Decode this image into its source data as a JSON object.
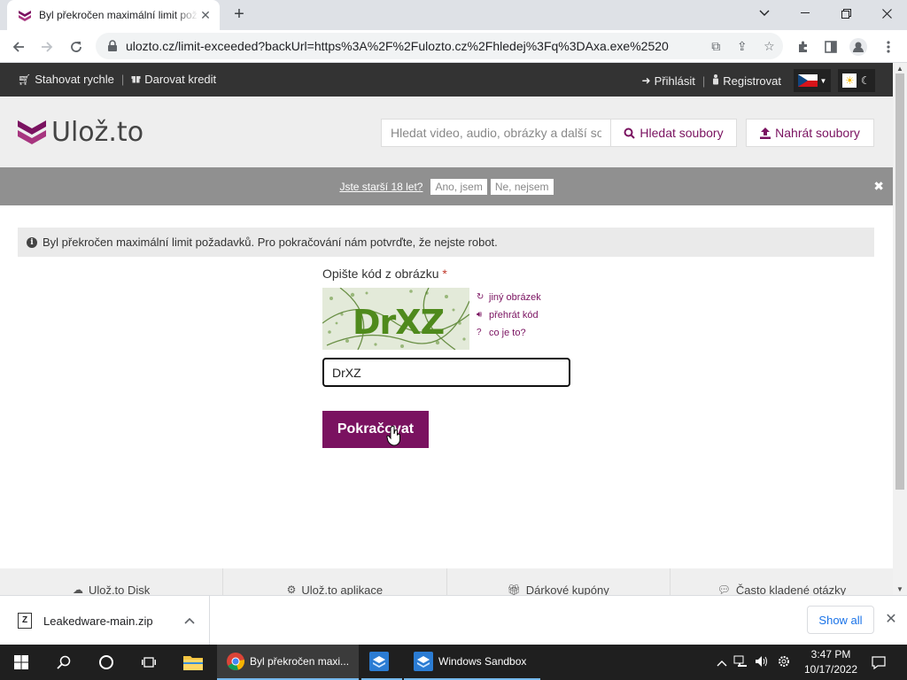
{
  "browser": {
    "tab_title": "Byl překročen maximální limit požadavků",
    "url": "ulozto.cz/limit-exceeded?backUrl=https%3A%2F%2Fulozto.cz%2Fhledej%3Fq%3DAxa.exe%2520"
  },
  "site": {
    "topbar": {
      "fast_download": "Stahovat rychle",
      "separator": "|",
      "donate_credit": "Darovat kredit",
      "login": "Přihlásit",
      "register": "Registrovat"
    },
    "logo_text": "Ulož.to",
    "search": {
      "placeholder": "Hledat video, audio, obrázky a další soubory",
      "button": "Hledat soubory"
    },
    "upload_button": "Nahrát soubory",
    "age_bar": {
      "question": "Jste starší 18 let?",
      "yes": "Ano, jsem",
      "no": "Ne, nejsem"
    },
    "alert_text": "Byl překročen maximální limit požadavků. Pro pokračování nám potvrďte, že nejste robot.",
    "captcha": {
      "label": "Opište kód z obrázku",
      "required_mark": "*",
      "image_text": "DrXZ",
      "other_image": "jiný obrázek",
      "play_code": "přehrát kód",
      "what_is_it": "co je to?",
      "input_value": "DrXZ"
    },
    "continue_button": "Pokračovat",
    "footer_nav": [
      "Ulož.to Disk",
      "Ulož.to aplikace",
      "Dárkové kupóny",
      "Často kladené otázky"
    ]
  },
  "downloads": {
    "file_name": "Leakedware-main.zip",
    "show_all": "Show all"
  },
  "taskbar": {
    "chrome_window": "Byl překročen maxi...",
    "sandbox_window": "Windows Sandbox",
    "time": "3:47 PM",
    "date": "10/17/2022"
  },
  "colors": {
    "brand": "#7a1260",
    "topbar": "#333333",
    "age_bar": "#909090"
  }
}
